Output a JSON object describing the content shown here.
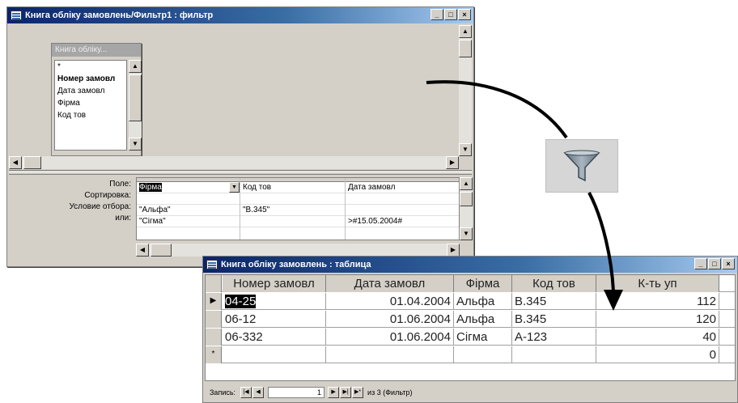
{
  "filter_window": {
    "title": "Книга обліку замовлень/Фильтр1 : фильтр",
    "field_list": {
      "title": "Книга обліку...",
      "items": [
        "*",
        "Номер замовл",
        "Дата замовл",
        "Фірма",
        "Код тов"
      ]
    },
    "row_labels": [
      "Поле:",
      "Сортировка:",
      "Условие отбора:",
      "или:"
    ],
    "columns": [
      {
        "field": "Фірма",
        "sort": "",
        "criteria": "\"Альфа\"",
        "or": "\"Сігма\""
      },
      {
        "field": "Код тов",
        "sort": "",
        "criteria": "\"B.345\"",
        "or": ""
      },
      {
        "field": "Дата замовл",
        "sort": "",
        "criteria": "",
        "or": ">#15.05.2004#"
      }
    ]
  },
  "table_window": {
    "title": "Книга обліку замовлень : таблица",
    "headers": [
      "Номер замовл",
      "Дата замовл",
      "Фірма",
      "Код тов",
      "К-ть уп"
    ],
    "rows": [
      [
        "04-25",
        "01.04.2004",
        "Альфа",
        "B.345",
        "112"
      ],
      [
        "06-12",
        "01.06.2004",
        "Альфа",
        "B.345",
        "120"
      ],
      [
        "06-332",
        "01.06.2004",
        "Сігма",
        "A-123",
        "40"
      ],
      [
        "",
        "",
        "",
        "",
        "0"
      ]
    ],
    "new_row_marker": "*",
    "current_row_marker": "▶",
    "nav": {
      "label": "Запись:",
      "current": "1",
      "total_text": "из 3 (Фильтр)"
    }
  },
  "icons": {
    "filter": "filter-funnel-icon",
    "arrow": "curved-arrow"
  }
}
